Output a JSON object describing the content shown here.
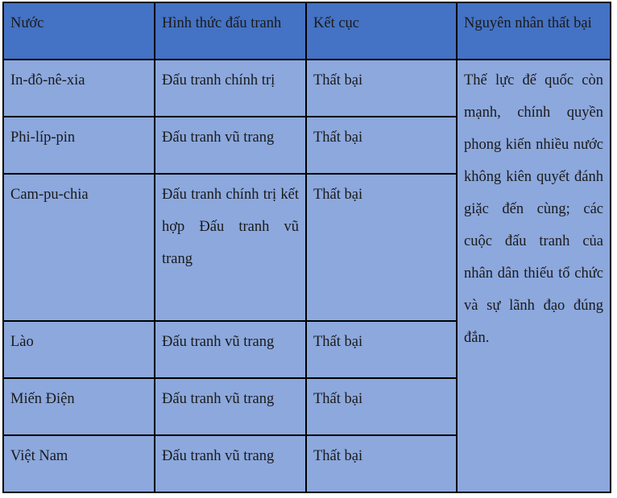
{
  "table": {
    "columns": [
      {
        "key": "country",
        "header": "Nước"
      },
      {
        "key": "form",
        "header": "Hình thức đấu tranh"
      },
      {
        "key": "result",
        "header": "Kết cục"
      },
      {
        "key": "cause",
        "header": "Nguyên nhân thất bại"
      }
    ],
    "headers": {
      "country": "Nước",
      "form": "Hình thức đấu tranh",
      "result": "Kết cục",
      "cause": "Nguyên nhân thất bại"
    },
    "rows": [
      {
        "country": "In-đô-nê-xia",
        "form": "Đấu tranh chính trị",
        "result": "Thất bại"
      },
      {
        "country": "Phi-líp-pin",
        "form": "Đấu tranh vũ trang",
        "result": "Thất bại"
      },
      {
        "country": "Cam-pu-chia",
        "form": "Đấu tranh chính trị kết hợp Đấu tranh vũ trang",
        "result": "Thất bại"
      },
      {
        "country": "Lào",
        "form": "Đấu tranh vũ trang",
        "result": "Thất bại"
      },
      {
        "country": "Miến Điện",
        "form": "Đấu tranh vũ trang",
        "result": "Thất bại"
      },
      {
        "country": "Việt Nam",
        "form": "Đấu tranh vũ trang",
        "result": "Thất bại"
      }
    ],
    "merged_cause_cell": "Thế lực đế quốc còn mạnh, chính quyền phong kiến nhiều nước không kiên quyết đánh giặc đến cùng; các cuộc đấu tranh của nhân dân thiếu tổ chức và sự lãnh đạo đúng đắn.",
    "colors": {
      "header_background": "#4472C4",
      "body_background": "#8CA8DD",
      "border": "#000000",
      "text": "#1a1a1a",
      "page_background": "#ffffff"
    }
  }
}
